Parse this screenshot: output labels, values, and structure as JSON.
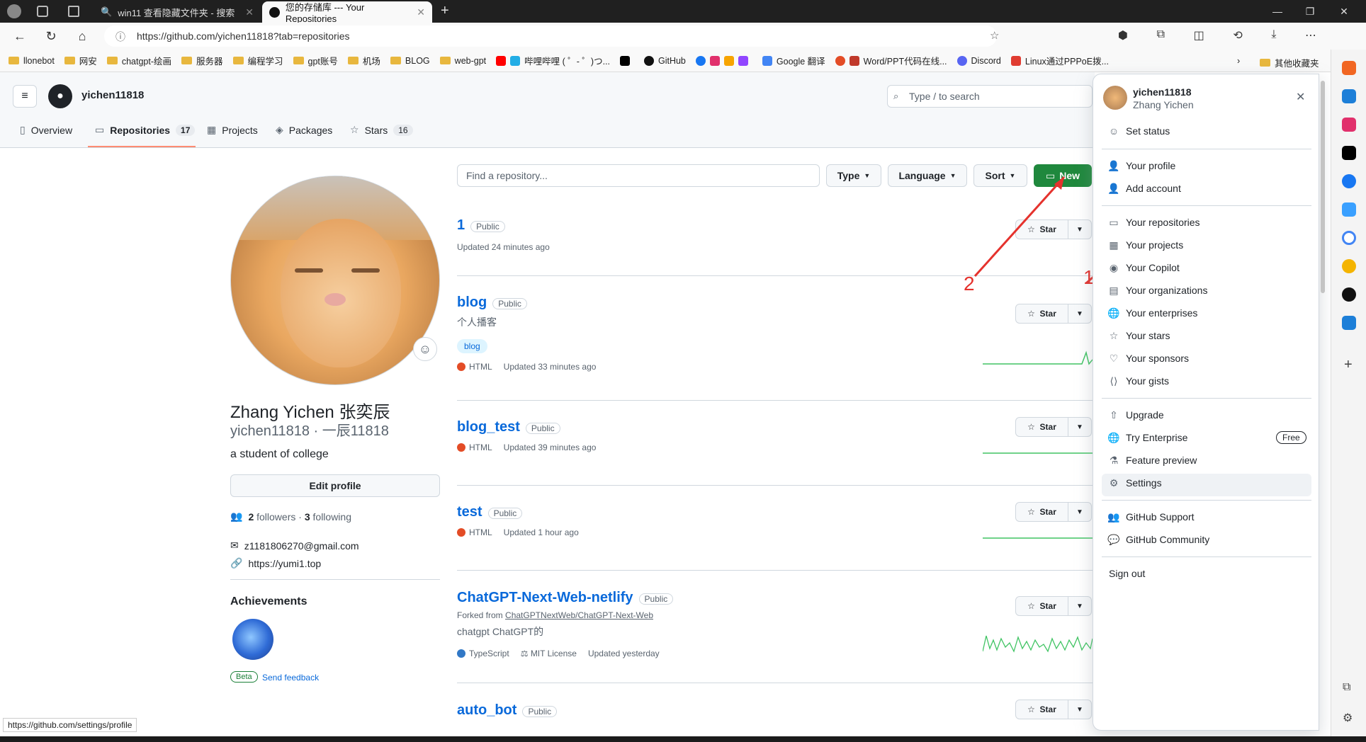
{
  "browser": {
    "tabs": [
      {
        "title": "win11 查看隐藏文件夹 - 搜索"
      },
      {
        "title": "您的存储库 --- Your Repositories"
      }
    ],
    "new_tab": "+",
    "url": "https://github.com/yichen11818?tab=repositories",
    "status_url": "https://github.com/settings/profile",
    "bookmarks": [
      "llonebot",
      "网安",
      "chatgpt-绘画",
      "服务器",
      "编程学习",
      "gpt账号",
      "机场",
      "BLOG",
      "web-gpt",
      "哔哩哔哩 ( ゜- ゜)つ...",
      "GitHub",
      "Google 翻译",
      "Word/PPT代码在线...",
      "Discord",
      "Linux通过PPPoE拨...",
      "其他收藏夹"
    ]
  },
  "github": {
    "username": "yichen11818",
    "search_placeholder": "Type / to search",
    "tabs": [
      {
        "label": "Overview",
        "icon": "book-icon"
      },
      {
        "label": "Repositories",
        "count": "17",
        "icon": "repo-icon"
      },
      {
        "label": "Projects",
        "icon": "table-icon"
      },
      {
        "label": "Packages",
        "icon": "package-icon"
      },
      {
        "label": "Stars",
        "count": "16",
        "icon": "star-icon"
      }
    ]
  },
  "profile": {
    "full_name": "Zhang Yichen  张奕辰",
    "login": "yichen11818 · 一辰11818",
    "bio": "a student of college",
    "edit_label": "Edit profile",
    "followers": "2",
    "followers_label": "followers",
    "following": "3",
    "following_label": "following",
    "email": "z1181806270@gmail.com",
    "website": "https://yumi1.top",
    "achievements_title": "Achievements",
    "beta": "Beta",
    "feedback": "Send feedback"
  },
  "filters": {
    "find_placeholder": "Find a repository...",
    "type": "Type",
    "language": "Language",
    "sort": "Sort",
    "new": "New"
  },
  "repos": [
    {
      "name": "1",
      "visibility": "Public",
      "updated": "Updated 24 minutes ago"
    },
    {
      "name": "blog",
      "visibility": "Public",
      "desc": "个人播客",
      "topic": "blog",
      "lang": "HTML",
      "updated": "Updated 33 minutes ago"
    },
    {
      "name": "blog_test",
      "visibility": "Public",
      "lang": "HTML",
      "updated": "Updated 39 minutes ago"
    },
    {
      "name": "test",
      "visibility": "Public",
      "lang": "HTML",
      "updated": "Updated 1 hour ago"
    },
    {
      "name": "ChatGPT-Next-Web-netlify",
      "visibility": "Public",
      "forked_from_label": "Forked from",
      "forked_from": "ChatGPTNextWeb/ChatGPT-Next-Web",
      "desc": "chatgpt  ChatGPT的",
      "lang": "TypeScript",
      "license": "MIT License",
      "updated": "Updated yesterday"
    },
    {
      "name": "auto_bot",
      "visibility": "Public"
    }
  ],
  "star_label": "Star",
  "colors": {
    "html": "#e34c26",
    "typescript": "#3178c6",
    "green": "#1f883d",
    "link": "#0969da",
    "annotation": "#e5322d"
  },
  "panel": {
    "username": "yichen11818",
    "full_name": "Zhang Yichen",
    "set_status": "Set status",
    "items1": [
      "Your profile",
      "Add account"
    ],
    "items2": [
      "Your repositories",
      "Your projects",
      "Your Copilot",
      "Your organizations",
      "Your enterprises",
      "Your stars",
      "Your sponsors",
      "Your gists"
    ],
    "items3": [
      "Upgrade",
      "Try Enterprise",
      "Feature preview",
      "Settings"
    ],
    "free": "Free",
    "items4": [
      "GitHub Support",
      "GitHub Community"
    ],
    "sign_out": "Sign out"
  },
  "annotations": {
    "label1": "1",
    "label2": "2"
  }
}
